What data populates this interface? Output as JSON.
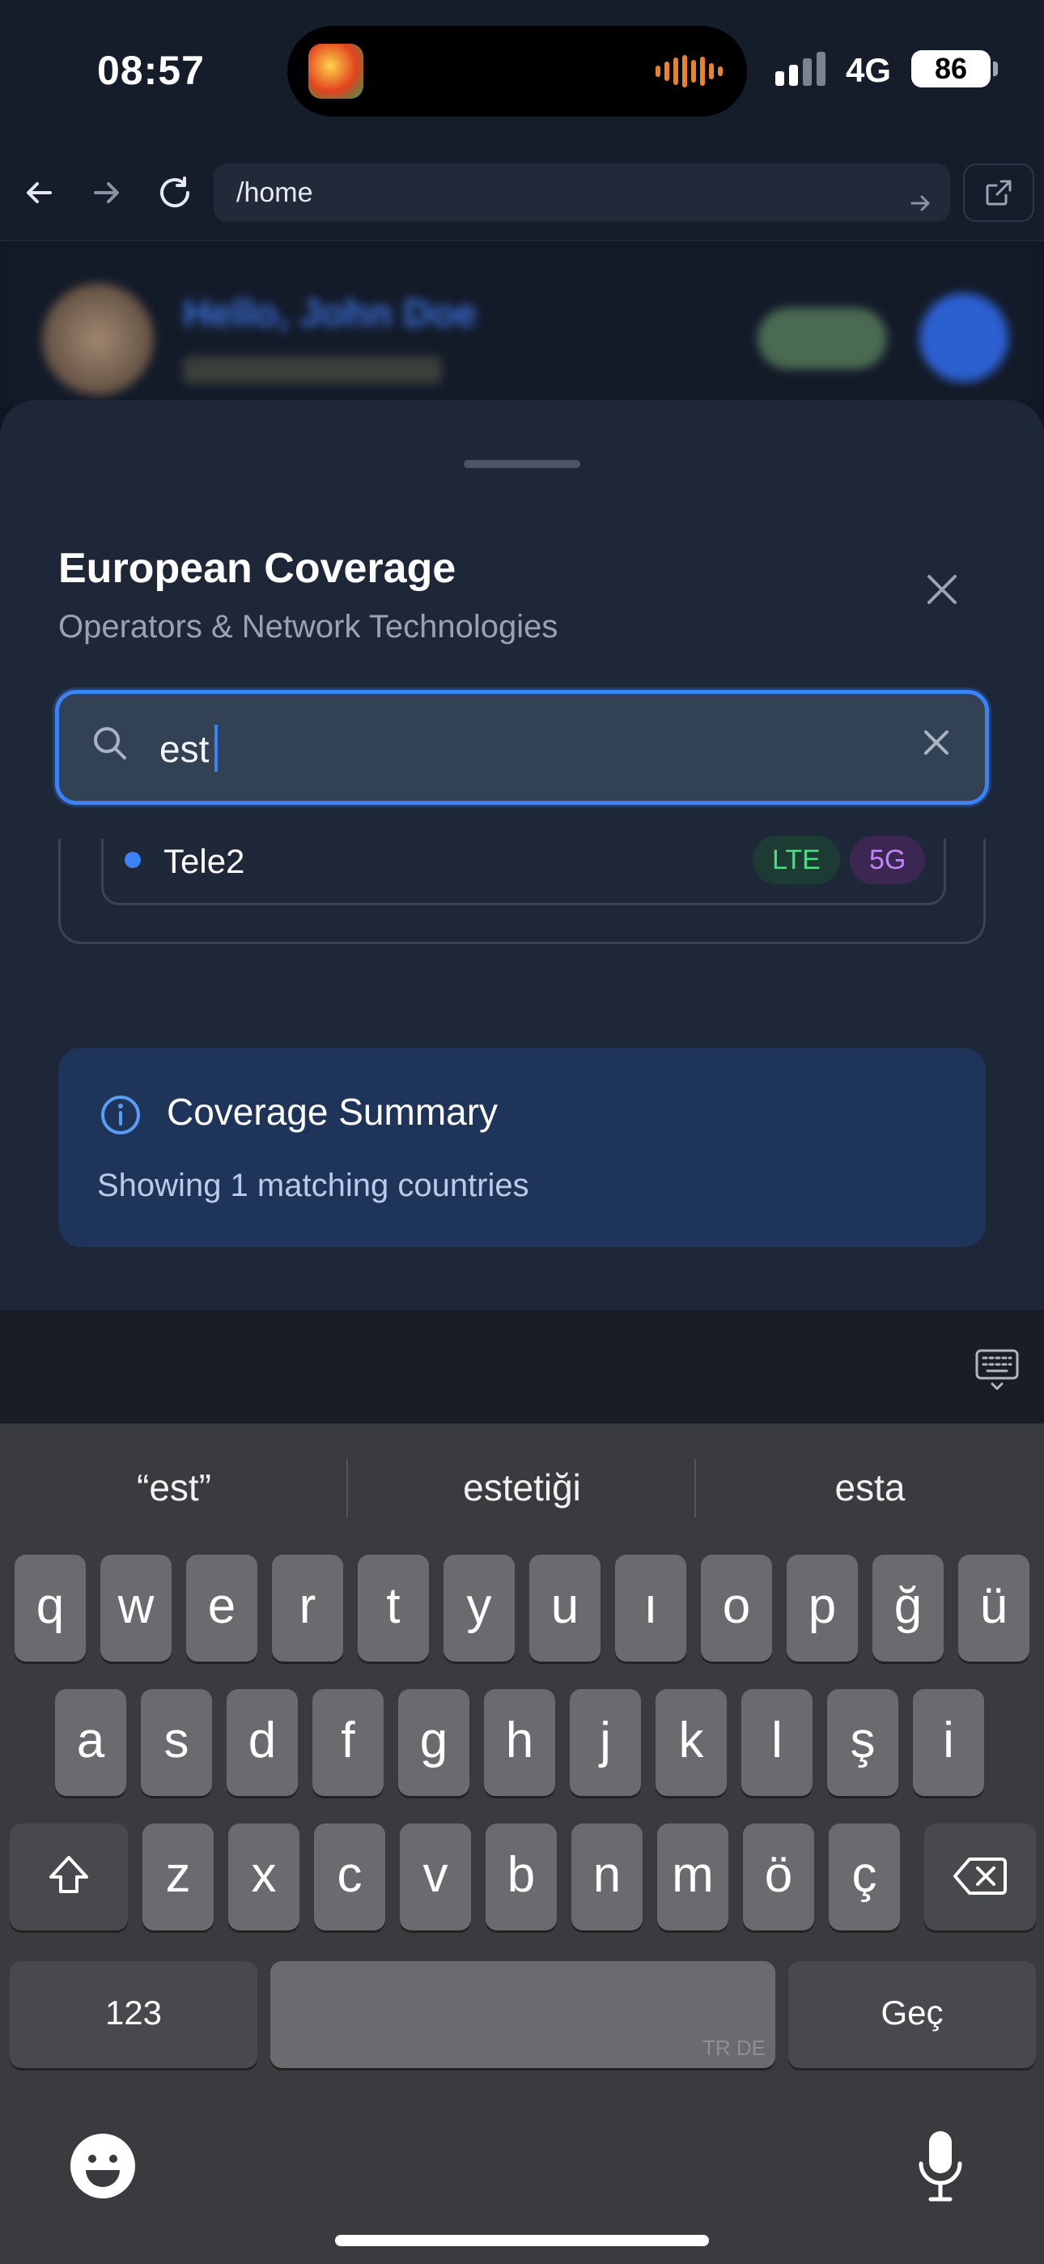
{
  "status_bar": {
    "time": "08:57",
    "network": "4G",
    "battery": "86"
  },
  "browser": {
    "url": "/home"
  },
  "background_header": {
    "greeting": "Hello,",
    "user_name": "John Doe"
  },
  "sheet": {
    "title": "European Coverage",
    "subtitle": "Operators & Network Technologies",
    "search": {
      "value": "est",
      "placeholder": ""
    },
    "operators": [
      {
        "name": "Tele2",
        "tags": [
          "LTE",
          "5G"
        ]
      }
    ],
    "summary": {
      "title": "Coverage Summary",
      "text": "Showing 1 matching countries"
    }
  },
  "keyboard": {
    "suggestions": [
      "“est”",
      "estetiği",
      "esta"
    ],
    "row1": [
      "q",
      "w",
      "e",
      "r",
      "t",
      "y",
      "u",
      "ı",
      "o",
      "p",
      "ğ",
      "ü"
    ],
    "row2": [
      "a",
      "s",
      "d",
      "f",
      "g",
      "h",
      "j",
      "k",
      "l",
      "ş",
      "i"
    ],
    "row3": [
      "z",
      "x",
      "c",
      "v",
      "b",
      "n",
      "m",
      "ö",
      "ç"
    ],
    "numbers_label": "123",
    "space_lang": "TR DE",
    "return_label": "Geç"
  },
  "colors": {
    "accent": "#3b82f6",
    "lte": "#4ade80",
    "five_g": "#c084fc"
  }
}
